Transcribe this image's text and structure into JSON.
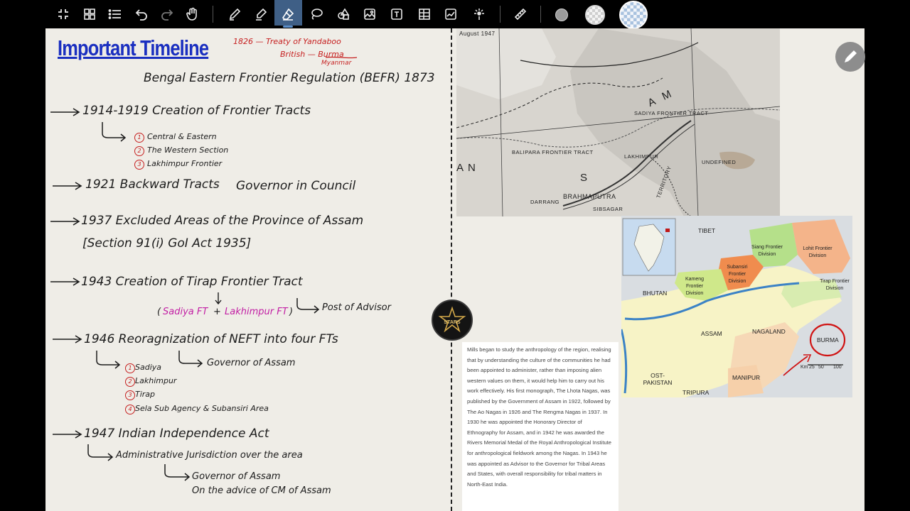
{
  "toolbar": {
    "items": [
      "collapse-icon",
      "grid-icon",
      "list-icon",
      "undo-icon",
      "redo-icon",
      "hand-pen-icon",
      "pen-icon",
      "highlighter-icon",
      "eraser-icon",
      "lasso-icon",
      "shapes-icon",
      "image-icon",
      "text-icon",
      "table-icon",
      "chart-icon",
      "laser-icon",
      "ruler-icon",
      "dot-color",
      "light-color",
      "checker-color"
    ],
    "colors": {
      "active_bg": "#3f5f86",
      "dot": "#9b9b9b"
    }
  },
  "notes": {
    "title": "Important Timeline",
    "treaty_line1": "1826 — Treaty of Yandaboo",
    "treaty_line2": "British — Burma",
    "treaty_line3": "Myanmar",
    "befr": "Bengal Eastern Frontier Regulation (BEFR) 1873",
    "e1914": "1914-1919 Creation of Frontier Tracts",
    "e1914_items": [
      "Central & Eastern",
      "The Western Section",
      "Lakhimpur Frontier"
    ],
    "e1921": "1921 Backward Tracts",
    "governor_council": "Governor in Council",
    "e1937": "1937 Excluded Areas of the Province of Assam",
    "e1937_sub": "[Section 91(i) GoI Act 1935]",
    "e1943": "1943 Creation of Tirap Frontier Tract",
    "sadiya_ft": "Sadiya FT",
    "plus": "+",
    "lakhimpur_ft": "Lakhimpur FT",
    "open_paren": "(",
    "close_paren": ")",
    "post_advisor": "Post of Advisor",
    "e1946": "1946 Reoragnization of NEFT into four FTs",
    "e1946_items": [
      "Sadiya",
      "Lakhimpur",
      "Tirap",
      "Sela Sub Agency & Subansiri Area"
    ],
    "e1946_governor": "Governor of Assam",
    "e1947": "1947 Indian Independence Act",
    "admin": "Administrative Jurisdiction over the area",
    "gov_assam": "Governor of Assam",
    "advice": "On the advice of CM of Assam",
    "num_labels": [
      "1",
      "2",
      "3"
    ],
    "num_labels2": [
      "1",
      "2",
      "3",
      "4"
    ]
  },
  "map1": {
    "caption": "August 1947",
    "labels": [
      "SADIYA FRONTIER TRACT",
      "BALIPARA FRONTIER TRACT",
      "LAKHIMPUR",
      "UNDEFINED",
      "BRAHMAPUTRA",
      "SIBSAGAR",
      "DARRANG",
      "AN",
      "AM",
      "S",
      "TERRITORY"
    ]
  },
  "map2": {
    "labels": [
      "TIBET",
      "Siang Frontier Division",
      "Lohit Frontier Division",
      "Subansiri Frontier Division",
      "Kameng Frontier Division",
      "Tirap Frontier Division",
      "BHUTAN",
      "ASSAM",
      "NAGALAND",
      "BURMA",
      "Km",
      "25",
      "50",
      "100",
      "OST-PAKISTAN",
      "MANIPUR",
      "TRIPURA"
    ]
  },
  "excerpt": {
    "text": "Mills began to study the anthropology of the region, realising that by understanding the culture of the communities he had been appointed to administer, rather than imposing alien western values on them, it would help him to carry out his work effectively. His first monograph, The Lhota Nagas, was published by the Government of Assam in 1922, followed by The Ao Nagas in 1926 and The Rengma Nagas in 1937. In 1930 he was appointed the Honorary Director of Ethnography for Assam, and in 1942 he was awarded the Rivers Memorial Medal of the Royal Anthropological Institute for anthropological fieldwork among the Nagas. In 1943 he was appointed as Advisor to the Governor for Tribal Areas and States, with overall responsibility for tribal matters in North-East India."
  },
  "logo": {
    "text": "STARS"
  }
}
